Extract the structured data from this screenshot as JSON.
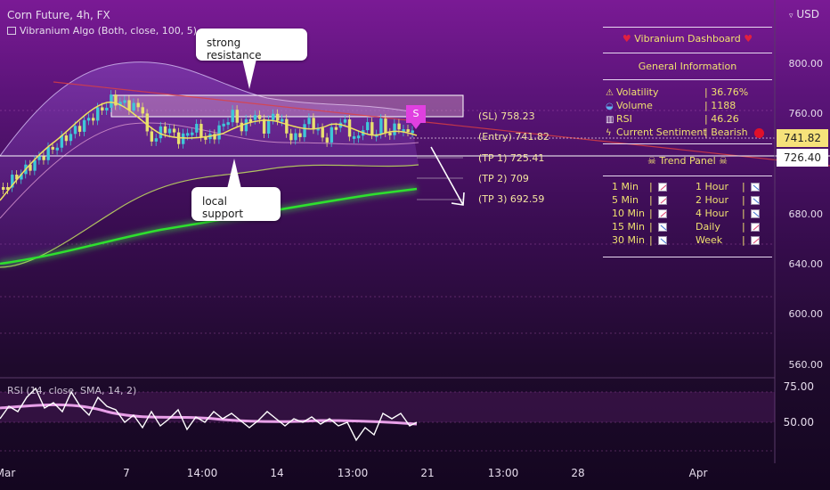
{
  "chart": {
    "symbol_line": "Corn Future, 4h, FX",
    "indicator_label": "Vibranium Algo (Both, close, 100, 5)",
    "currency": "USD",
    "currency_icon": "chevron-down-icon"
  },
  "callouts": {
    "resistance": "strong resistance",
    "support": "local support"
  },
  "signal_marker": "S",
  "trade_levels": {
    "sl": "(SL) 758.23",
    "entry": "(Entry) 741.82",
    "tp1": "(TP 1) 725.41",
    "tp2": "(TP 2) 709",
    "tp3": "(TP 3) 692.59"
  },
  "price_axis": {
    "labels": [
      "800.00",
      "760.00",
      "680.00",
      "640.00",
      "600.00",
      "560.00"
    ],
    "current_price": "741.82",
    "support_price": "726.40"
  },
  "time_axis": {
    "labels": [
      "Mar",
      "7",
      "14:00",
      "14",
      "13:00",
      "21",
      "13:00",
      "28",
      "Apr"
    ]
  },
  "rsi": {
    "title": "RSI (14, close, SMA, 14, 2)",
    "labels": [
      "75.00",
      "50.00"
    ]
  },
  "dashboard": {
    "title": "Vibranium Dashboard",
    "title_icon": "heart-icon",
    "general_title": "General Information",
    "general": [
      {
        "icon": "warning-icon",
        "label": "Volatility",
        "value": "| 36.76%"
      },
      {
        "icon": "water-icon",
        "label": "Volume",
        "value": "| 1188"
      },
      {
        "icon": "bar-chart-icon",
        "label": "RSI",
        "value": "| 46.26"
      },
      {
        "icon": "lightning-icon",
        "label": "Current Sentiment",
        "value": "| Bearish"
      }
    ],
    "sentiment_color": "#e0102a",
    "trend_title": "Trend Panel",
    "trend_icon": "skull-icon",
    "trend_rows": [
      {
        "left": "1 Min",
        "left_trend": "up",
        "right": "1 Hour",
        "right_trend": "down"
      },
      {
        "left": "5 Min",
        "left_trend": "up",
        "right": "2 Hour",
        "right_trend": "down"
      },
      {
        "left": "10 Min",
        "left_trend": "up",
        "right": "4 Hour",
        "right_trend": "down"
      },
      {
        "left": "15 Min",
        "left_trend": "down",
        "right": "Daily",
        "right_trend": "up"
      },
      {
        "left": "30 Min",
        "left_trend": "down",
        "right": "Week",
        "right_trend": "up"
      }
    ]
  },
  "colors": {
    "dashboard_text": "#f0e070",
    "bullish_candle": "#3ec7d8",
    "bearish_candle": "#e8e070",
    "ma_line": "#2ee02e",
    "signal": "#e040e0",
    "entry_badge": "#f6e27a",
    "rsi_line": "#e8a0e8"
  }
}
